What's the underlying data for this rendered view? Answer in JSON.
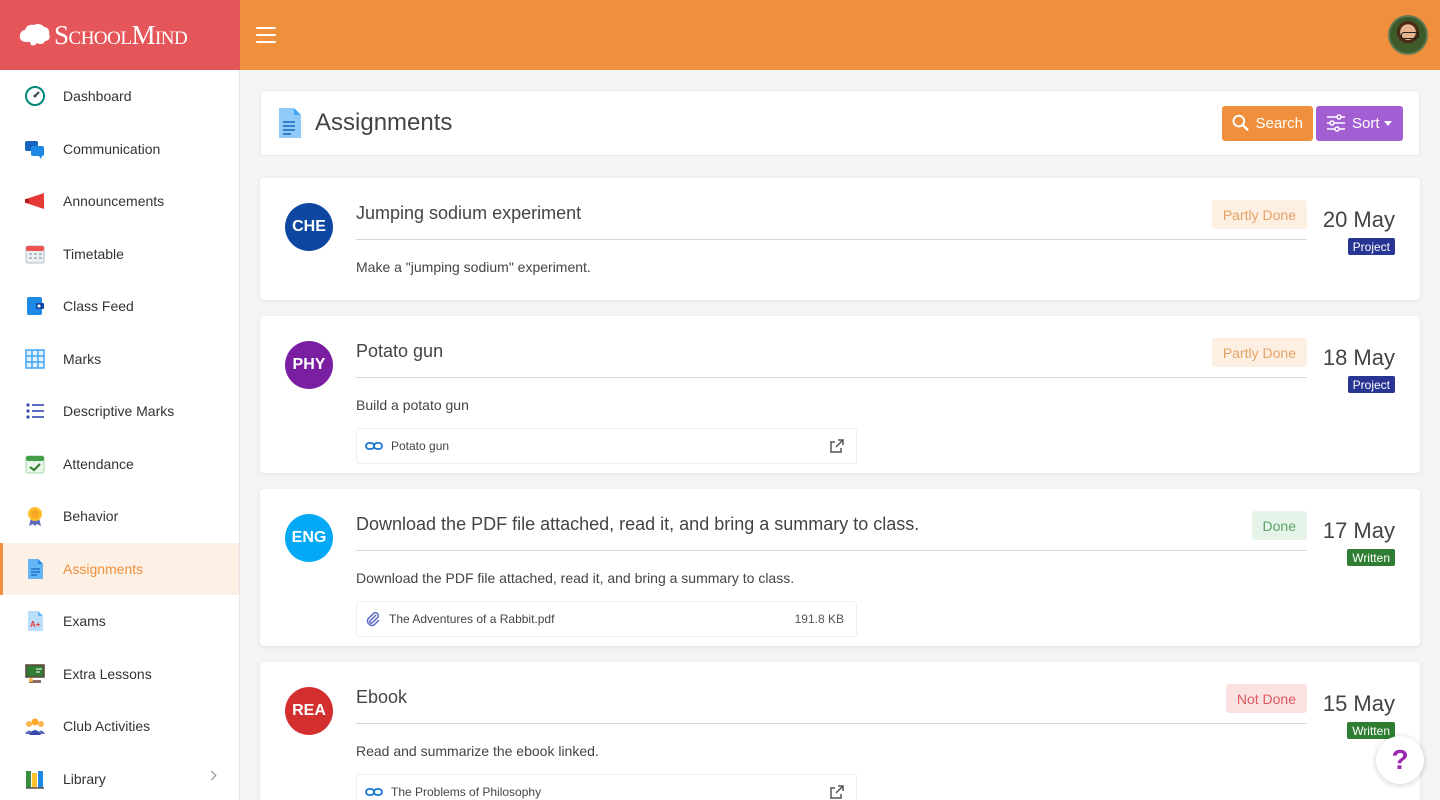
{
  "brand": {
    "name": "SchoolMind"
  },
  "colors": {
    "topbar": "#f08f3c",
    "brand_bg": "#e5565a",
    "search_button": "#f08f3c",
    "sort_button": "#a25fd4",
    "active_nav": "#f08f3c"
  },
  "sidebar": {
    "items": [
      {
        "label": "Dashboard",
        "icon": "dashboard-gauge-icon"
      },
      {
        "label": "Communication",
        "icon": "chat-bubbles-icon"
      },
      {
        "label": "Announcements",
        "icon": "megaphone-icon"
      },
      {
        "label": "Timetable",
        "icon": "calendar-icon"
      },
      {
        "label": "Class Feed",
        "icon": "class-feed-icon"
      },
      {
        "label": "Marks",
        "icon": "grid-icon"
      },
      {
        "label": "Descriptive Marks",
        "icon": "bulleted-list-icon"
      },
      {
        "label": "Attendance",
        "icon": "calendar-check-icon"
      },
      {
        "label": "Behavior",
        "icon": "medal-icon"
      },
      {
        "label": "Assignments",
        "icon": "document-icon",
        "active": true
      },
      {
        "label": "Exams",
        "icon": "graded-paper-icon"
      },
      {
        "label": "Extra Lessons",
        "icon": "blackboard-icon"
      },
      {
        "label": "Club Activities",
        "icon": "group-icon"
      },
      {
        "label": "Library",
        "icon": "books-icon",
        "has_submenu": true
      }
    ]
  },
  "header": {
    "title": "Assignments",
    "search_label": "Search",
    "sort_label": "Sort"
  },
  "assignments": [
    {
      "subject": "CHE",
      "subject_color": "#0d47a1",
      "title": "Jumping sodium experiment",
      "description": "Make a \"jumping sodium\" experiment.",
      "status": "Partly Done",
      "date": "20 May",
      "type": "Project"
    },
    {
      "subject": "PHY",
      "subject_color": "#7b1fa2",
      "title": "Potato gun",
      "description": "Build a potato gun",
      "status": "Partly Done",
      "date": "18 May",
      "type": "Project",
      "attachment": {
        "kind": "link",
        "name": "Potato gun"
      }
    },
    {
      "subject": "ENG",
      "subject_color": "#03a9f4",
      "title": "Download the PDF file attached, read it, and bring a summary to class.",
      "description": "Download the PDF file attached, read it, and bring a summary to class.",
      "status": "Done",
      "date": "17 May",
      "type": "Written",
      "attachment": {
        "kind": "file",
        "name": "The Adventures of a Rabbit.pdf",
        "size": "191.8 KB"
      }
    },
    {
      "subject": "REA",
      "subject_color": "#d32f2f",
      "title": "Ebook",
      "description": "Read and summarize the ebook linked.",
      "status": "Not Done",
      "date": "15 May",
      "type": "Written",
      "attachment": {
        "kind": "link",
        "name": "The Problems of Philosophy"
      }
    }
  ],
  "help": {
    "label": "?"
  }
}
